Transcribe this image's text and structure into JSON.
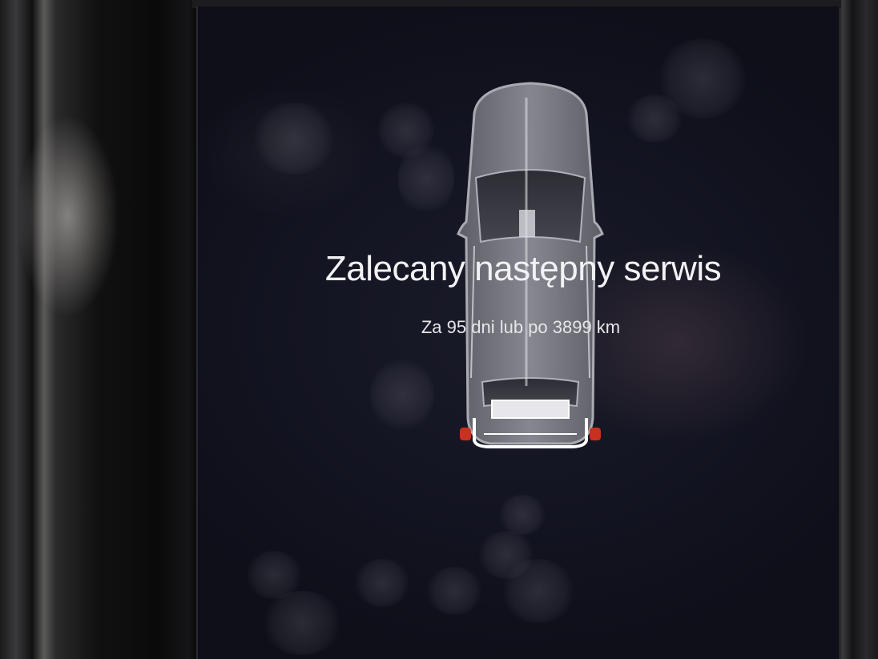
{
  "service_notice": {
    "title": "Zalecany następny serwis",
    "subtitle": "Za 95 dni lub po 3899 km"
  },
  "icons": {
    "vehicle": "car-top-view-icon"
  },
  "colors": {
    "screen_background": "#15161f",
    "text": "#f2f2f5",
    "tail_light": "#c8301f"
  }
}
